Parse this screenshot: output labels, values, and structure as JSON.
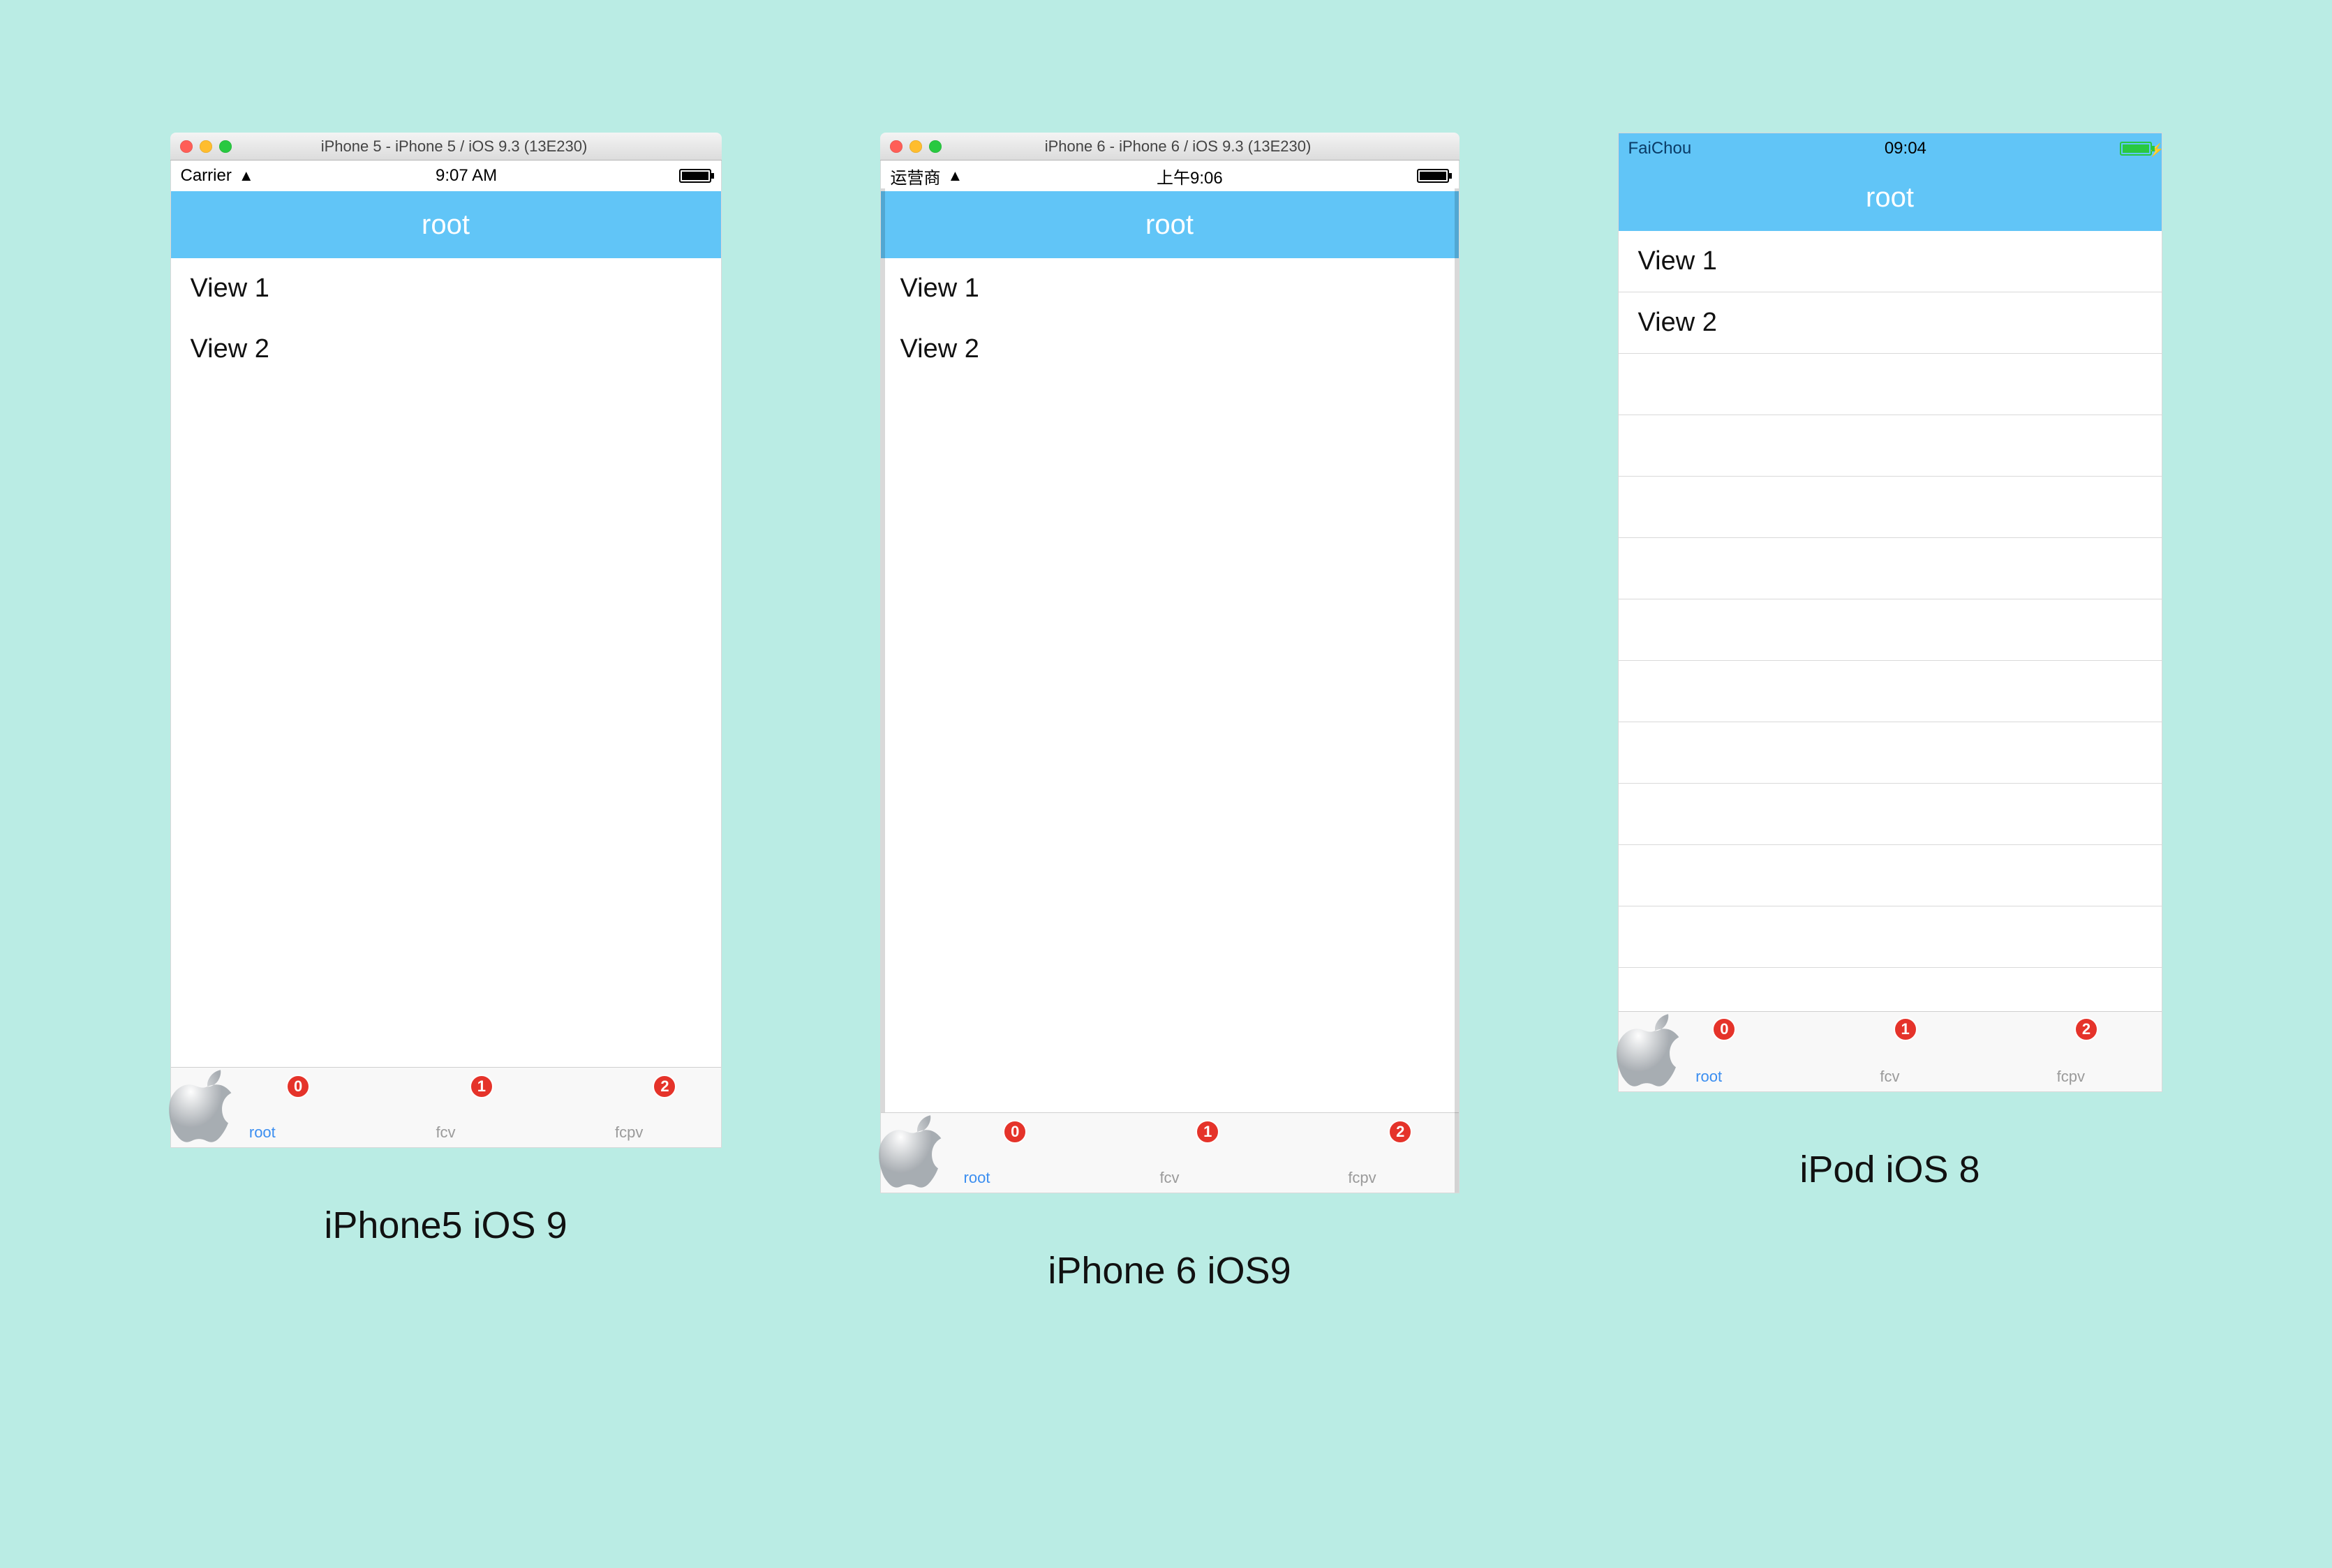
{
  "devices": [
    {
      "id": "iphone5",
      "caption": "iPhone5 iOS 9",
      "mac_title": "iPhone 5 - iPhone 5 / iOS 9.3 (13E230)",
      "status": {
        "carrier": "Carrier",
        "time": "9:07 AM",
        "battery_style": "black"
      },
      "nav_title": "root",
      "rows": [
        "View 1",
        "View 2"
      ],
      "show_separators": false,
      "tabs": [
        {
          "label": "root",
          "badge": "0",
          "active": true,
          "apple": true
        },
        {
          "label": "fcv",
          "badge": "1",
          "active": false
        },
        {
          "label": "fcpv",
          "badge": "2",
          "active": false
        }
      ]
    },
    {
      "id": "iphone6",
      "caption": "iPhone 6 iOS9",
      "mac_title": "iPhone 6 - iPhone 6 / iOS 9.3 (13E230)",
      "status": {
        "carrier": "运营商",
        "time": "上午9:06",
        "battery_style": "black"
      },
      "nav_title": "root",
      "rows": [
        "View 1",
        "View 2"
      ],
      "show_separators": false,
      "tabs": [
        {
          "label": "root",
          "badge": "0",
          "active": true,
          "apple": true
        },
        {
          "label": "fcv",
          "badge": "1",
          "active": false
        },
        {
          "label": "fcpv",
          "badge": "2",
          "active": false
        }
      ]
    },
    {
      "id": "ipod",
      "caption": "iPod iOS 8",
      "mac_title": "",
      "status": {
        "carrier": "FaiChou",
        "time": "09:04",
        "battery_style": "green"
      },
      "nav_title": "root",
      "rows": [
        "View 1",
        "View 2"
      ],
      "show_separators": true,
      "tabs": [
        {
          "label": "root",
          "badge": "0",
          "active": true,
          "apple": true
        },
        {
          "label": "fcv",
          "badge": "1",
          "active": false
        },
        {
          "label": "fcpv",
          "badge": "2",
          "active": false
        }
      ]
    }
  ]
}
